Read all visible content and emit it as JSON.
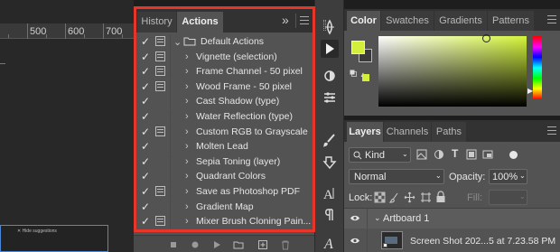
{
  "ruler": {
    "marks": [
      "500",
      "600",
      "700"
    ]
  },
  "canvas": {
    "hint_text": "✕ Hide suggestions"
  },
  "actions_panel": {
    "tabs": [
      {
        "label": "History"
      },
      {
        "label": "Actions"
      }
    ],
    "collapse_glyph": "»",
    "items": [
      {
        "label": "Default Actions",
        "checked": true,
        "dialog": true,
        "type": "set"
      },
      {
        "label": "Vignette (selection)",
        "checked": true,
        "dialog": true,
        "type": "action"
      },
      {
        "label": "Frame Channel - 50 pixel",
        "checked": true,
        "dialog": true,
        "type": "action"
      },
      {
        "label": "Wood Frame - 50 pixel",
        "checked": true,
        "dialog": true,
        "type": "action"
      },
      {
        "label": "Cast Shadow (type)",
        "checked": true,
        "dialog": false,
        "type": "action"
      },
      {
        "label": "Water Reflection (type)",
        "checked": true,
        "dialog": false,
        "type": "action"
      },
      {
        "label": "Custom RGB to Grayscale",
        "checked": true,
        "dialog": true,
        "type": "action"
      },
      {
        "label": "Molten Lead",
        "checked": true,
        "dialog": false,
        "type": "action"
      },
      {
        "label": "Sepia Toning (layer)",
        "checked": true,
        "dialog": false,
        "type": "action"
      },
      {
        "label": "Quadrant Colors",
        "checked": true,
        "dialog": false,
        "type": "action"
      },
      {
        "label": "Save as Photoshop PDF",
        "checked": true,
        "dialog": true,
        "type": "action"
      },
      {
        "label": "Gradient Map",
        "checked": true,
        "dialog": false,
        "type": "action"
      },
      {
        "label": "Mixer Brush Cloning Pain...",
        "checked": true,
        "dialog": true,
        "type": "action"
      }
    ],
    "bottom_icons": [
      "stop-icon",
      "record-icon",
      "play-icon",
      "new-set-folder-icon",
      "new-action-icon",
      "trash-icon"
    ]
  },
  "color_panel": {
    "tabs": [
      {
        "label": "Color"
      },
      {
        "label": "Swatches"
      },
      {
        "label": "Gradients"
      },
      {
        "label": "Patterns"
      }
    ],
    "foreground_color": "#d4ee3c",
    "background_color": "#3a3a3a",
    "hue_color": "#d4f53a"
  },
  "layers_panel": {
    "tabs": [
      {
        "label": "Layers"
      },
      {
        "label": "Channels"
      },
      {
        "label": "Paths"
      }
    ],
    "filter_value": "Kind",
    "blend_mode": "Normal",
    "opacity_label": "Opacity:",
    "opacity_value": "100%",
    "lock_label": "Lock:",
    "fill_label": "Fill:",
    "fill_value": "100%",
    "artboard_name": "Artboard 1",
    "layer_name": "Screen Shot 202...5 at 7.23.58 PM"
  }
}
